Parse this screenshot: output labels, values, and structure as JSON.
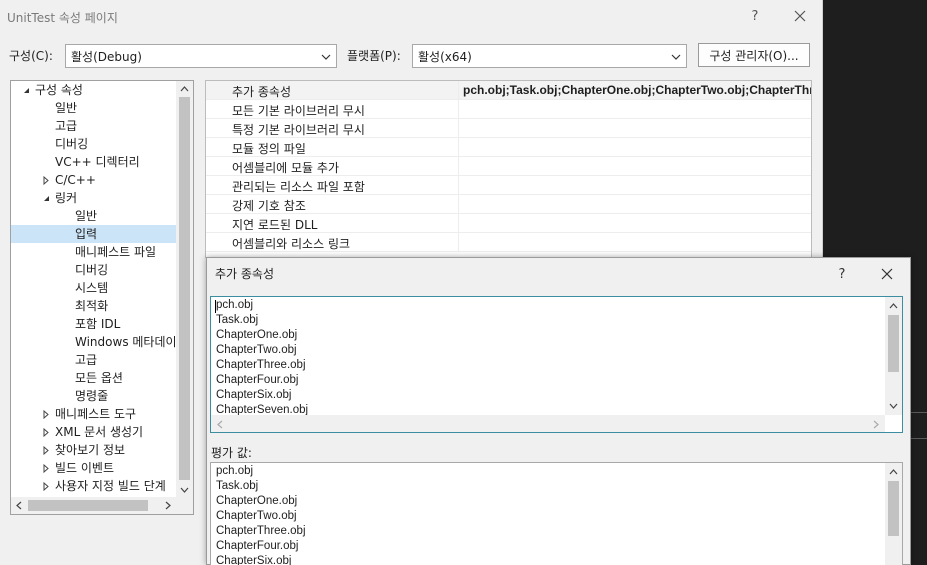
{
  "window": {
    "title": "UnitTest 속성 페이지",
    "help_glyph": "?",
    "config_label": "구성(C):",
    "config_value": "활성(Debug)",
    "platform_label": "플랫폼(P):",
    "platform_value": "활성(x64)",
    "config_manager_label": "구성 관리자(O)..."
  },
  "tree": {
    "items": [
      {
        "label": "구성 속성",
        "level": 0,
        "expander": "open"
      },
      {
        "label": "일반",
        "level": 1,
        "expander": "none"
      },
      {
        "label": "고급",
        "level": 1,
        "expander": "none"
      },
      {
        "label": "디버깅",
        "level": 1,
        "expander": "none"
      },
      {
        "label": "VC++ 디렉터리",
        "level": 1,
        "expander": "none"
      },
      {
        "label": "C/C++",
        "level": 1,
        "expander": "closed"
      },
      {
        "label": "링커",
        "level": 1,
        "expander": "open"
      },
      {
        "label": "일반",
        "level": 2,
        "expander": "none"
      },
      {
        "label": "입력",
        "level": 2,
        "expander": "none",
        "selected": true
      },
      {
        "label": "매니페스트 파일",
        "level": 2,
        "expander": "none"
      },
      {
        "label": "디버깅",
        "level": 2,
        "expander": "none"
      },
      {
        "label": "시스템",
        "level": 2,
        "expander": "none"
      },
      {
        "label": "최적화",
        "level": 2,
        "expander": "none"
      },
      {
        "label": "포함 IDL",
        "level": 2,
        "expander": "none"
      },
      {
        "label": "Windows 메타데이",
        "level": 2,
        "expander": "none"
      },
      {
        "label": "고급",
        "level": 2,
        "expander": "none"
      },
      {
        "label": "모든 옵션",
        "level": 2,
        "expander": "none"
      },
      {
        "label": "명령줄",
        "level": 2,
        "expander": "none"
      },
      {
        "label": "매니페스트 도구",
        "level": 1,
        "expander": "closed"
      },
      {
        "label": "XML 문서 생성기",
        "level": 1,
        "expander": "closed"
      },
      {
        "label": "찾아보기 정보",
        "level": 1,
        "expander": "closed"
      },
      {
        "label": "빌드 이벤트",
        "level": 1,
        "expander": "closed"
      },
      {
        "label": "사용자 지정 빌드 단계",
        "level": 1,
        "expander": "closed"
      }
    ]
  },
  "grid": {
    "rows": [
      {
        "name": "추가 종속성",
        "value": "pch.obj;Task.obj;ChapterOne.obj;ChapterTwo.obj;ChapterThr"
      },
      {
        "name": "모든 기본 라이브러리 무시",
        "value": ""
      },
      {
        "name": "특정 기본 라이브러리 무시",
        "value": ""
      },
      {
        "name": "모듈 정의 파일",
        "value": ""
      },
      {
        "name": "어셈블리에 모듈 추가",
        "value": ""
      },
      {
        "name": "관리되는 리소스 파일 포함",
        "value": ""
      },
      {
        "name": "강제 기호 참조",
        "value": ""
      },
      {
        "name": "지연 로드된 DLL",
        "value": ""
      },
      {
        "name": "어셈블리와 리소스 링크",
        "value": ""
      }
    ]
  },
  "dialog": {
    "title": "추가 종속성",
    "help_glyph": "?",
    "edit_lines": [
      "pch.obj",
      "Task.obj",
      "ChapterOne.obj",
      "ChapterTwo.obj",
      "ChapterThree.obj",
      "ChapterFour.obj",
      "ChapterSix.obj",
      "ChapterSeven.obj"
    ],
    "evaluated_label": "평가 값:",
    "evaluated_lines": [
      "pch.obj",
      "Task.obj",
      "ChapterOne.obj",
      "ChapterTwo.obj",
      "ChapterThree.obj",
      "ChapterFour.obj",
      "ChapterSix.obj"
    ]
  },
  "icons": {
    "close": "close-icon",
    "help": "help-icon",
    "expand_open": "triangle-down-icon",
    "expand_closed": "triangle-right-icon",
    "combo_arrow": "chevron-down-icon"
  },
  "colors": {
    "window_bg": "#f0f0f0",
    "selection": "#cce4f7",
    "focus_border": "#3c8da0",
    "outer_bg": "#1e1e1e"
  }
}
